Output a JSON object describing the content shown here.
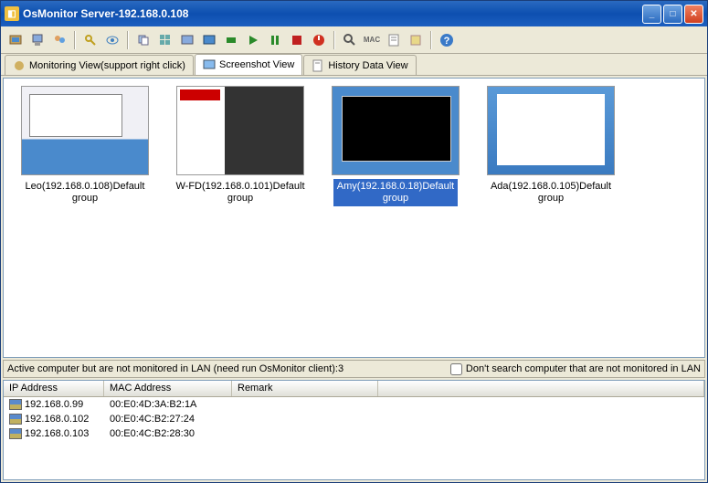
{
  "window": {
    "title": "OsMonitor Server-192.168.0.108"
  },
  "tabs": [
    {
      "label": "Monitoring View(support right click)"
    },
    {
      "label": "Screenshot View"
    },
    {
      "label": "History Data View"
    }
  ],
  "thumbnails": [
    {
      "label_line1": "Leo(192.168.0.108)Default",
      "label_line2": "group",
      "selected": false
    },
    {
      "label_line1": "W-FD(192.168.0.101)Default",
      "label_line2": "group",
      "selected": false
    },
    {
      "label_line1": "Amy(192.168.0.18)Default",
      "label_line2": "group",
      "selected": true
    },
    {
      "label_line1": "Ada(192.168.0.105)Default",
      "label_line2": "group",
      "selected": false
    }
  ],
  "status": {
    "text": "Active computer but are not monitored in LAN (need run OsMonitor client):3",
    "checkbox_label": "Don't search computer that are not monitored in LAN",
    "checked": false
  },
  "table": {
    "headers": {
      "ip": "IP Address",
      "mac": "MAC Address",
      "remark": "Remark"
    },
    "rows": [
      {
        "ip": "192.168.0.99",
        "mac": "00:E0:4D:3A:B2:1A",
        "remark": ""
      },
      {
        "ip": "192.168.0.102",
        "mac": "00:E0:4C:B2:27:24",
        "remark": ""
      },
      {
        "ip": "192.168.0.103",
        "mac": "00:E0:4C:B2:28:30",
        "remark": ""
      }
    ]
  },
  "toolbar_icons": [
    "monitor-icon",
    "pc-icon",
    "users-icon",
    "key-icon",
    "eye-icon",
    "copy-icon",
    "windows-icon",
    "screen-icon",
    "screen2-icon",
    "rec-icon",
    "play-icon",
    "pause-icon",
    "stop-icon",
    "power-icon",
    "search-icon",
    "mac-icon",
    "sheet-icon",
    "tag-icon",
    "help-icon"
  ],
  "colors": {
    "accent": "#3169c6",
    "panel": "#ece9d8",
    "border": "#7f9db9"
  }
}
